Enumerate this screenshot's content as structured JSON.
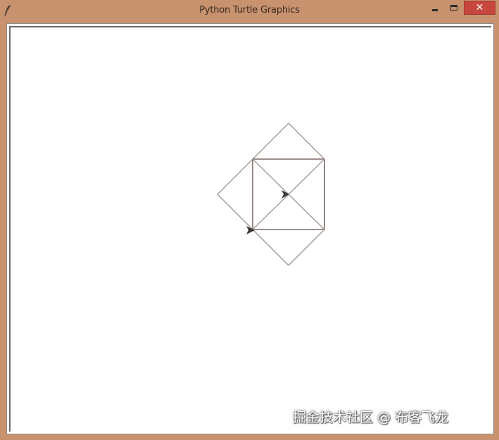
{
  "window": {
    "title": "Python Turtle Graphics",
    "icon": "feather-icon",
    "controls": {
      "minimize": "minimize-icon",
      "maximize": "maximize-icon",
      "close": "close-icon",
      "close_glyph": "✕"
    }
  },
  "canvas": {
    "background": "#ffffff",
    "line_colors": {
      "light": "#a39a96",
      "dark": "#7a6a66"
    },
    "turtle_color": "#3a3a3a",
    "turtles": [
      "turtle-arrow-icon",
      "turtle-arrow-icon"
    ]
  },
  "watermark": {
    "text": "掘金技术社区 @ 布客飞龙"
  },
  "colors": {
    "titlebar": "#c8926f",
    "close_button": "#c7473f"
  }
}
